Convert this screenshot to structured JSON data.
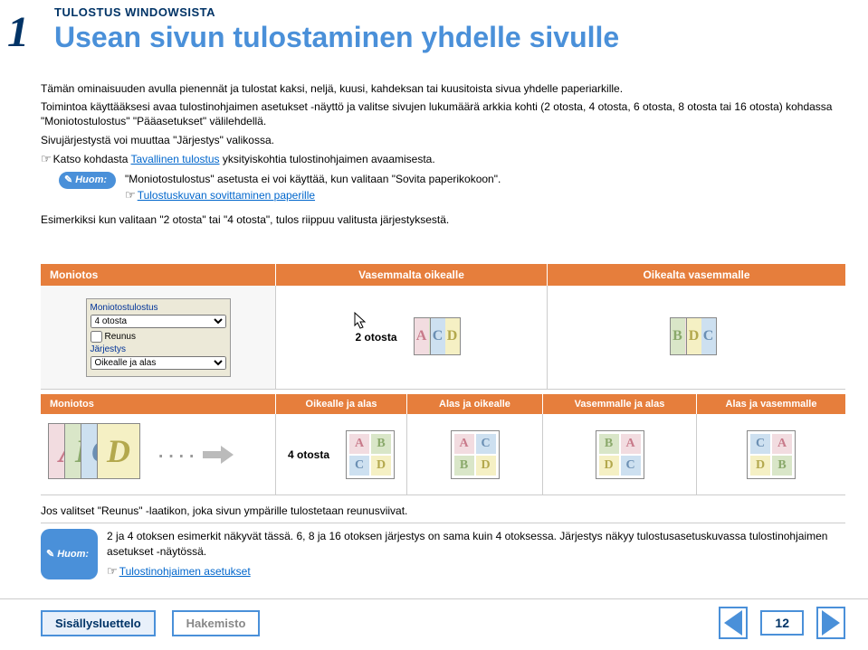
{
  "page_number_large": "1",
  "header": {
    "kicker": "TULOSTUS WINDOWSISTA",
    "title": "Usean sivun tulostaminen yhdelle sivulle"
  },
  "intro": {
    "p1": "Tämän ominaisuuden avulla pienennät ja tulostat kaksi, neljä, kuusi, kahdeksan tai kuusitoista sivua yhdelle paperiarkille.",
    "p2": "Toimintoa käyttääksesi avaa tulostinohjaimen asetukset -näyttö ja valitse sivujen lukumäärä arkkia kohti (2 otosta, 4 otosta, 6 otosta, 8 otosta tai 16 otosta) kohdassa \"Moniotostulostus\" \"Pääasetukset\" välilehdellä.",
    "p3": "Sivujärjestystä voi muuttaa \"Järjestys\" valikossa.",
    "p4_prefix": "Katso kohdasta ",
    "p4_link": "Tavallinen tulostus",
    "p4_suffix": " yksityiskohtia tulostinohjaimen avaamisesta."
  },
  "huom1": {
    "label": "Huom:",
    "line1": "\"Moniotostulostus\" asetusta ei voi käyttää, kun valitaan \"Sovita paperikokoon\".",
    "link": "Tulostuskuvan sovittaminen paperille"
  },
  "example_text": "Esimerkiksi kun valitaan \"2 otosta\" tai \"4 otosta\", tulos riippuu valitusta järjestyksestä.",
  "table1": {
    "headers": [
      "Moniotos",
      "Vasemmalta oikealle",
      "Oikealta vasemmalle"
    ],
    "row_label": "2 otosta"
  },
  "settings_mock": {
    "group": "Moniotostulostus",
    "select1": "4 otosta",
    "checkbox": "Reunus",
    "label2": "Järjestys",
    "select2": "Oikealle ja alas"
  },
  "table2": {
    "headers": [
      "Moniotos",
      "Oikealle ja alas",
      "Alas ja oikealle",
      "Vasemmalle ja alas",
      "Alas ja vasemmalle"
    ],
    "row_label": "4 otosta"
  },
  "letters": {
    "a": "A",
    "b": "B",
    "c": "C",
    "d": "D"
  },
  "footer1": "Jos valitset \"Reunus\" -laatikon, joka sivun ympärille tulostetaan reunusviivat.",
  "huom2": {
    "label": "Huom:",
    "text": "2 ja 4 otoksen esimerkit näkyvät tässä. 6, 8 ja 16 otoksen järjestys on sama kuin 4 otoksessa. Järjestys näkyy tulostusasetuskuvassa tulostinohjaimen asetukset -näytössä.",
    "link": "Tulostinohjaimen asetukset"
  },
  "bottom": {
    "toc": "Sisällysluettelo",
    "index": "Hakemisto",
    "page": "12"
  }
}
